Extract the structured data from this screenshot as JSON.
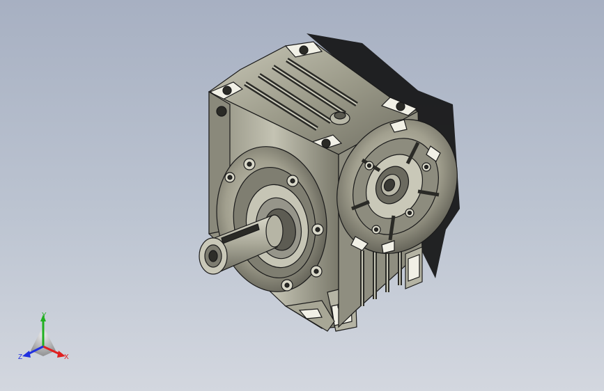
{
  "viewport": {
    "background_top": "#a7b0c2",
    "background_bottom": "#d3d7df"
  },
  "model": {
    "object": "worm-gear-reducer",
    "body_color": "#a8a796",
    "edge_color": "#1a1a1a",
    "shadow_color": "#111111"
  },
  "triad": {
    "x_label": "X",
    "y_label": "Y",
    "z_label": "Z",
    "x_color": "#e02020",
    "y_color": "#20b020",
    "z_color": "#2030e0"
  }
}
